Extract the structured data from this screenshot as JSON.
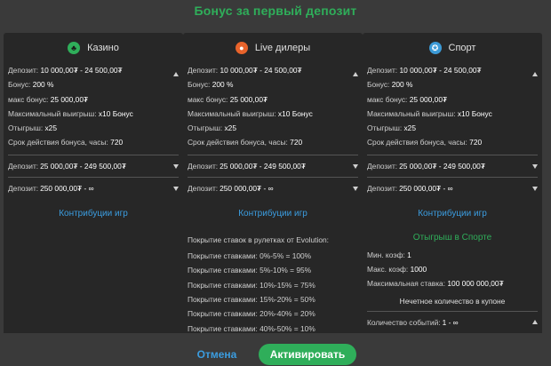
{
  "title": "Бонус за первый депозит",
  "columns": [
    {
      "name": "Казино",
      "icon": "casino-chip-icon",
      "deposit_label": "Депозит:",
      "deposit_value": "10 000,00₮ - 24 500,00₮",
      "bonus_label": "Бонус:",
      "bonus_value": "200 %",
      "max_bonus_label": "макс бонус:",
      "max_bonus_value": "25 000,00₮",
      "max_win_label": "Максимальный выигрыш:",
      "max_win_value": "x10 Бонус",
      "wager_label": "Отыгрыш:",
      "wager_value": "x25",
      "term_label": "Срок действия бонуса, часы:",
      "term_value": "720",
      "tier2_label": "Депозит:",
      "tier2_value": "25 000,00₮ - 249 500,00₮",
      "tier3_label": "Депозит:",
      "tier3_value": "250 000,00₮ - ∞",
      "contrib_link": "Контрибуции игр"
    },
    {
      "name": "Live дилеры",
      "icon": "live-dealer-icon",
      "deposit_label": "Депозит:",
      "deposit_value": "10 000,00₮ - 24 500,00₮",
      "bonus_label": "Бонус:",
      "bonus_value": "200 %",
      "max_bonus_label": "макс бонус:",
      "max_bonus_value": "25 000,00₮",
      "max_win_label": "Максимальный выигрыш:",
      "max_win_value": "x10 Бонус",
      "wager_label": "Отыгрыш:",
      "wager_value": "x25",
      "term_label": "Срок действия бонуса, часы:",
      "term_value": "720",
      "tier2_label": "Депозит:",
      "tier2_value": "25 000,00₮ - 249 500,00₮",
      "tier3_label": "Депозит:",
      "tier3_value": "250 000,00₮ - ∞",
      "contrib_link": "Контрибуции игр",
      "coverage_title": "Покрытие ставок в рулетках от Evolution:",
      "coverage": [
        "Покрытие ставками: 0%-5% = 100%",
        "Покрытие ставками: 5%-10% = 95%",
        "Покрытие ставками: 10%-15% = 75%",
        "Покрытие ставками: 15%-20% = 50%",
        "Покрытие ставками: 20%-40% = 20%",
        "Покрытие ставками: 40%-50% = 10%"
      ]
    },
    {
      "name": "Спорт",
      "icon": "sport-ball-icon",
      "deposit_label": "Депозит:",
      "deposit_value": "10 000,00₮ - 24 500,00₮",
      "bonus_label": "Бонус:",
      "bonus_value": "200 %",
      "max_bonus_label": "макс бонус:",
      "max_bonus_value": "25 000,00₮",
      "max_win_label": "Максимальный выигрыш:",
      "max_win_value": "x10 Бонус",
      "wager_label": "Отыгрыш:",
      "wager_value": "x25",
      "term_label": "Срок действия бонуса, часы:",
      "term_value": "720",
      "tier2_label": "Депозит:",
      "tier2_value": "25 000,00₮ - 249 500,00₮",
      "tier3_label": "Депозит:",
      "tier3_value": "250 000,00₮ - ∞",
      "contrib_link": "Контрибуции игр",
      "sport_title": "Отыгрыш в Спорте",
      "min_coef_label": "Мин. коэф:",
      "min_coef_value": "1",
      "max_coef_label": "Макс. коэф:",
      "max_coef_value": "1000",
      "max_bet_label": "Максимальная ставка:",
      "max_bet_value": "100 000 000,00₮",
      "odd_events": "Нечетное количество в купоне",
      "events_label": "Количество событий:",
      "events_value": "1 - ∞"
    }
  ],
  "buttons": {
    "cancel": "Отмена",
    "activate": "Активировать"
  },
  "colors": {
    "accent_green": "#2fae5a",
    "link_blue": "#3b9de0",
    "panel": "#272727",
    "background": "#3a3a3a"
  }
}
